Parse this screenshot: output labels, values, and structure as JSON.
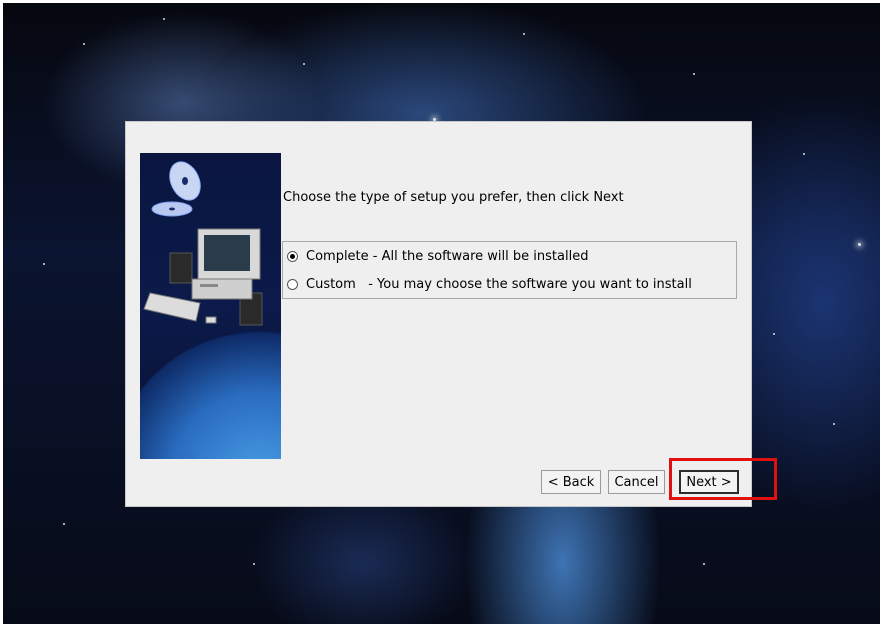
{
  "dialog": {
    "prompt": "Choose the type of setup you prefer, then click Next",
    "options": [
      {
        "name": "Complete",
        "sep": " - ",
        "desc": "All the software will be installed",
        "selected": true
      },
      {
        "name": "Custom",
        "sep": "   - ",
        "desc": "You may choose the software you want to install",
        "selected": false
      }
    ],
    "buttons": {
      "back": "< Back",
      "cancel": "Cancel",
      "next": "Next >"
    }
  },
  "icons": {
    "side_art": "computer-cd-planet-illustration"
  },
  "colors": {
    "highlight": "#e01010",
    "dialog_bg": "#efefef"
  }
}
